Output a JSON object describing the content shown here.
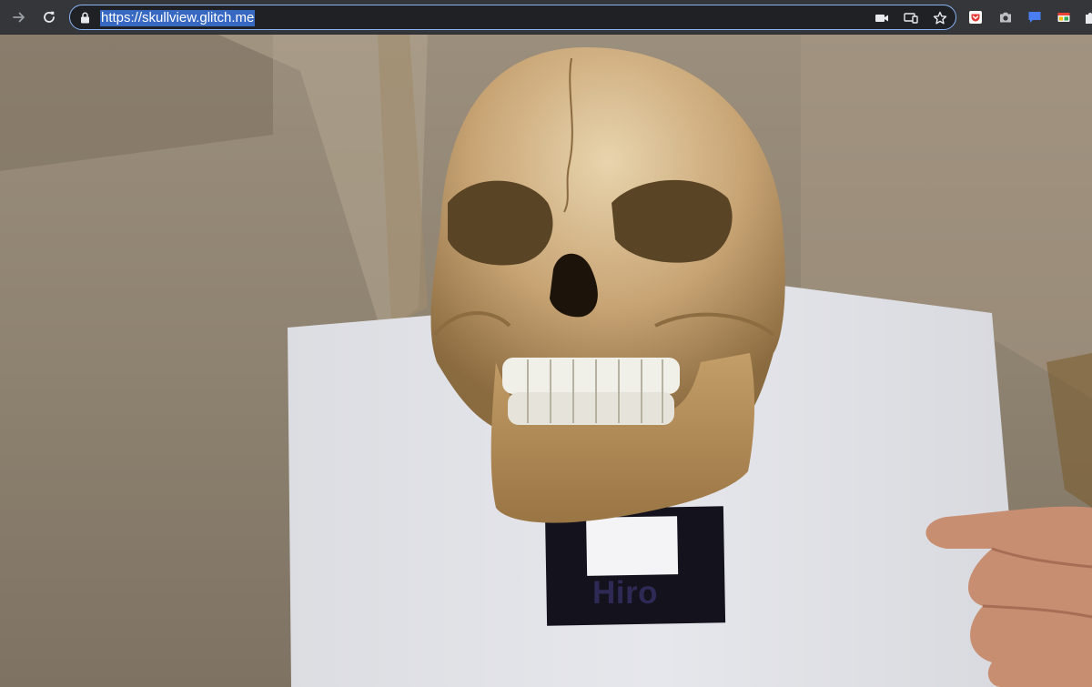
{
  "browser": {
    "url": "https://skullview.glitch.me",
    "url_selected": true,
    "accent_color": "#8ab4f8",
    "icons": {
      "back": "arrow-forward-icon",
      "reload": "reload-icon",
      "lock": "lock-icon",
      "camera": "video-camera-icon",
      "cast": "cast-icon",
      "bookmark": "star-icon",
      "extensions": [
        "pocket-icon",
        "camera-icon",
        "chat-icon",
        "extension-colorful-icon",
        "puzzle-icon"
      ]
    }
  },
  "ar_scene": {
    "marker_text": "Hiro",
    "model": "skull-3d-model",
    "background": "webcam-feed"
  }
}
